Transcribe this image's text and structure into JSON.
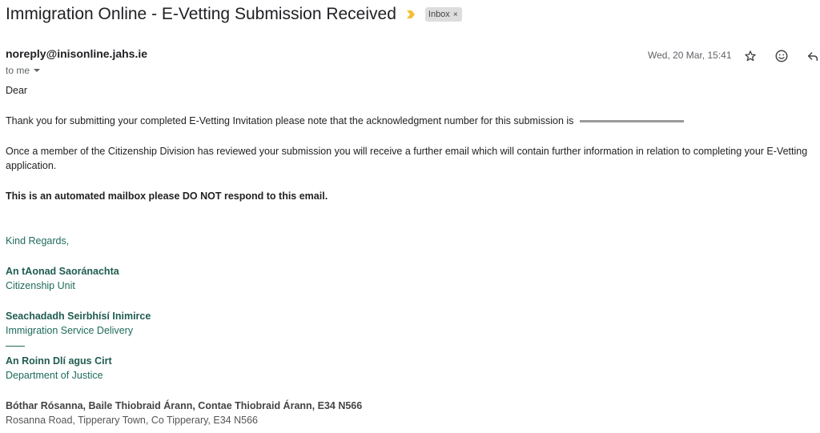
{
  "email": {
    "subject": "Immigration Online - E-Vetting Submission Received",
    "label": "Inbox",
    "label_remove": "×",
    "sender": "noreply@inisonline.jahs.ie",
    "recipient": "to me",
    "date": "Wed, 20 Mar, 15:41",
    "body": {
      "greeting": "Dear",
      "para1": "Thank you for submitting your completed E-Vetting Invitation please note that the acknowledgment number for this submission is",
      "para2": "Once a member of the Citizenship Division has reviewed your submission you will receive a further email which will contain further information in relation to completing your E-Vetting",
      "para2b": "application.",
      "notice": "This is an automated mailbox please DO NOT respond to this email."
    },
    "signature": {
      "closing": "Kind Regards,",
      "unit_ga": "An tAonad Saoránachta",
      "unit_en": "Citizenship Unit",
      "service_ga": "Seachadadh Seirbhísí Inimirce",
      "service_en": "Immigration Service Delivery",
      "dept_ga": "An Roinn Dlí agus Cirt",
      "dept_en": "Department of Justice",
      "address_ga": "Bóthar Rósanna, Baile Thiobraid Árann, Contae Thiobraid Árann, E34 N566",
      "address_en": "Rosanna Road, Tipperary Town, Co Tipperary, E34 N566"
    }
  },
  "icons": {
    "important": "important-marker-icon",
    "star": "star-icon",
    "emoji": "emoji-react-icon",
    "reply": "reply-icon"
  },
  "colors": {
    "signature_green": "#1f6b5b",
    "important_yellow": "#f2c037",
    "label_chip": "#dddddd"
  }
}
